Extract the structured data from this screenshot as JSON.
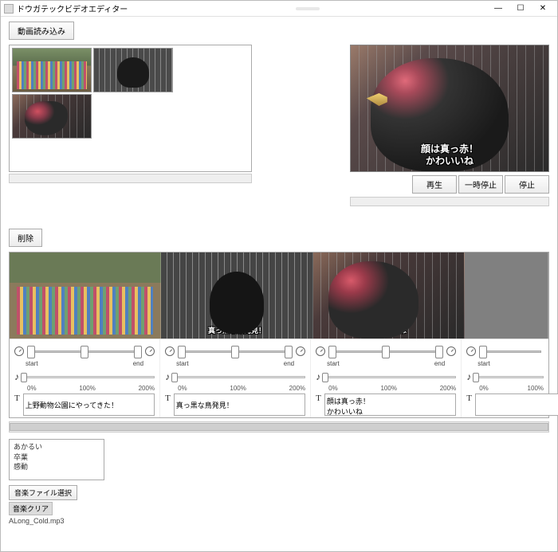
{
  "window": {
    "title": "ドウガテックビデオエディター"
  },
  "toolbar": {
    "load_button": "動画読み込み",
    "delete_button": "削除"
  },
  "preview": {
    "subtitle_line1": "顔は真っ赤！",
    "subtitle_line2": "かわいいね",
    "play": "再生",
    "pause": "一時停止",
    "stop": "停止"
  },
  "timeline": {
    "trim_start_label": "start",
    "trim_end_label": "end",
    "vol_0": "0%",
    "vol_100": "100%",
    "vol_200": "200%",
    "clips": [
      {
        "overlay": "上野動物公園にやってきた！",
        "text": "上野動物公園にやってきた！"
      },
      {
        "overlay": "真っ黒な鳥発見！",
        "text": "真っ黒な鳥発見！"
      },
      {
        "overlay": "顔は真っ赤！\nかわいいね",
        "text": "顔は真っ赤！\nかわいいね"
      },
      {
        "overlay": "",
        "text": ""
      }
    ]
  },
  "tags": {
    "line1": "あかるい",
    "line2": "卒業",
    "line3": "感動"
  },
  "audio": {
    "select_button": "音楽ファイル選択",
    "clear_button": "音楽クリア",
    "filename": "ALong_Cold.mp3"
  }
}
